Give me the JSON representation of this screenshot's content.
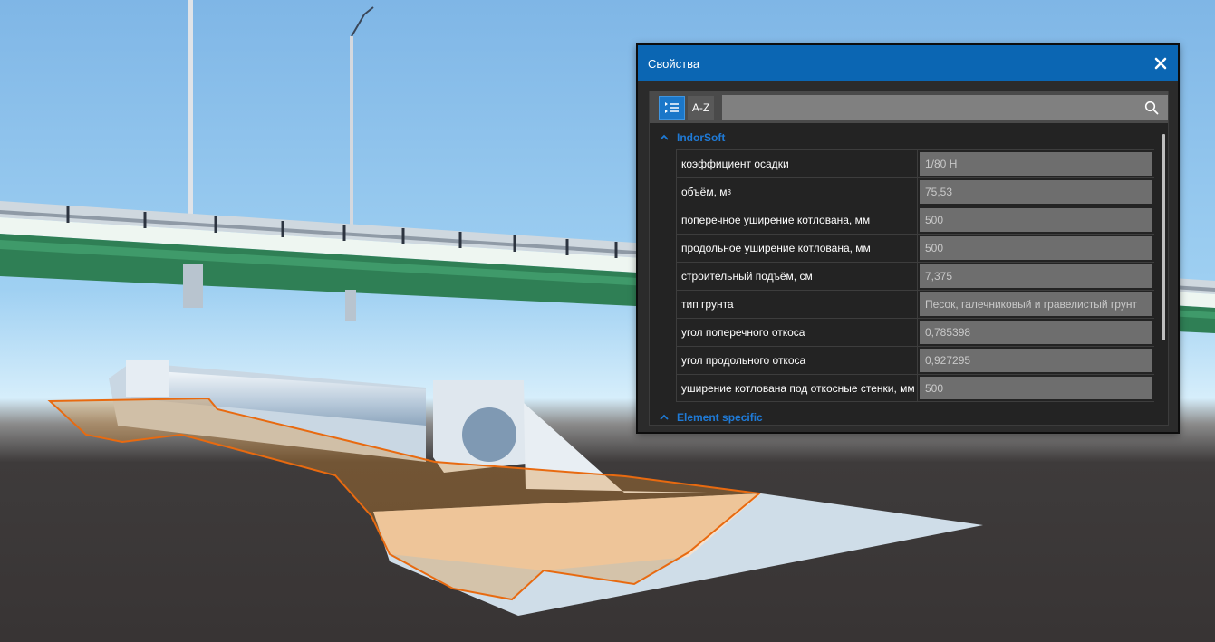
{
  "window": {
    "title": "Свойства",
    "close_icon": "close-icon"
  },
  "toolbar": {
    "categorized_icon": "categorized-list-icon",
    "az_label": "A-Z",
    "search_value": "",
    "search_icon": "search-icon"
  },
  "groups": [
    {
      "label": "IndorSoft",
      "icon": "chevron-up-icon"
    },
    {
      "label": "Element specific",
      "icon": "chevron-up-icon"
    }
  ],
  "properties": [
    {
      "name": "коэффициент осадки",
      "value": "1/80 H"
    },
    {
      "name": "объём, м",
      "sup": "3",
      "value": "75,53"
    },
    {
      "name": "поперечное уширение котлована, мм",
      "value": "500"
    },
    {
      "name": "продольное уширение котлована, мм",
      "value": "500"
    },
    {
      "name": "строительный подъём, см",
      "value": "7,375"
    },
    {
      "name": "тип грунта",
      "value": "Песок, галечниковый и гравелистый грунт"
    },
    {
      "name": "угол поперечного откоса",
      "value": "0,785398"
    },
    {
      "name": "угол продольного откоса",
      "value": "0,927295"
    },
    {
      "name": "уширение котлована под откосные стенки, мм",
      "value": "500"
    }
  ],
  "colors": {
    "titlebar": "#0b66b3",
    "accent": "#1f7ad6",
    "selection_outline": "#e86a10"
  }
}
